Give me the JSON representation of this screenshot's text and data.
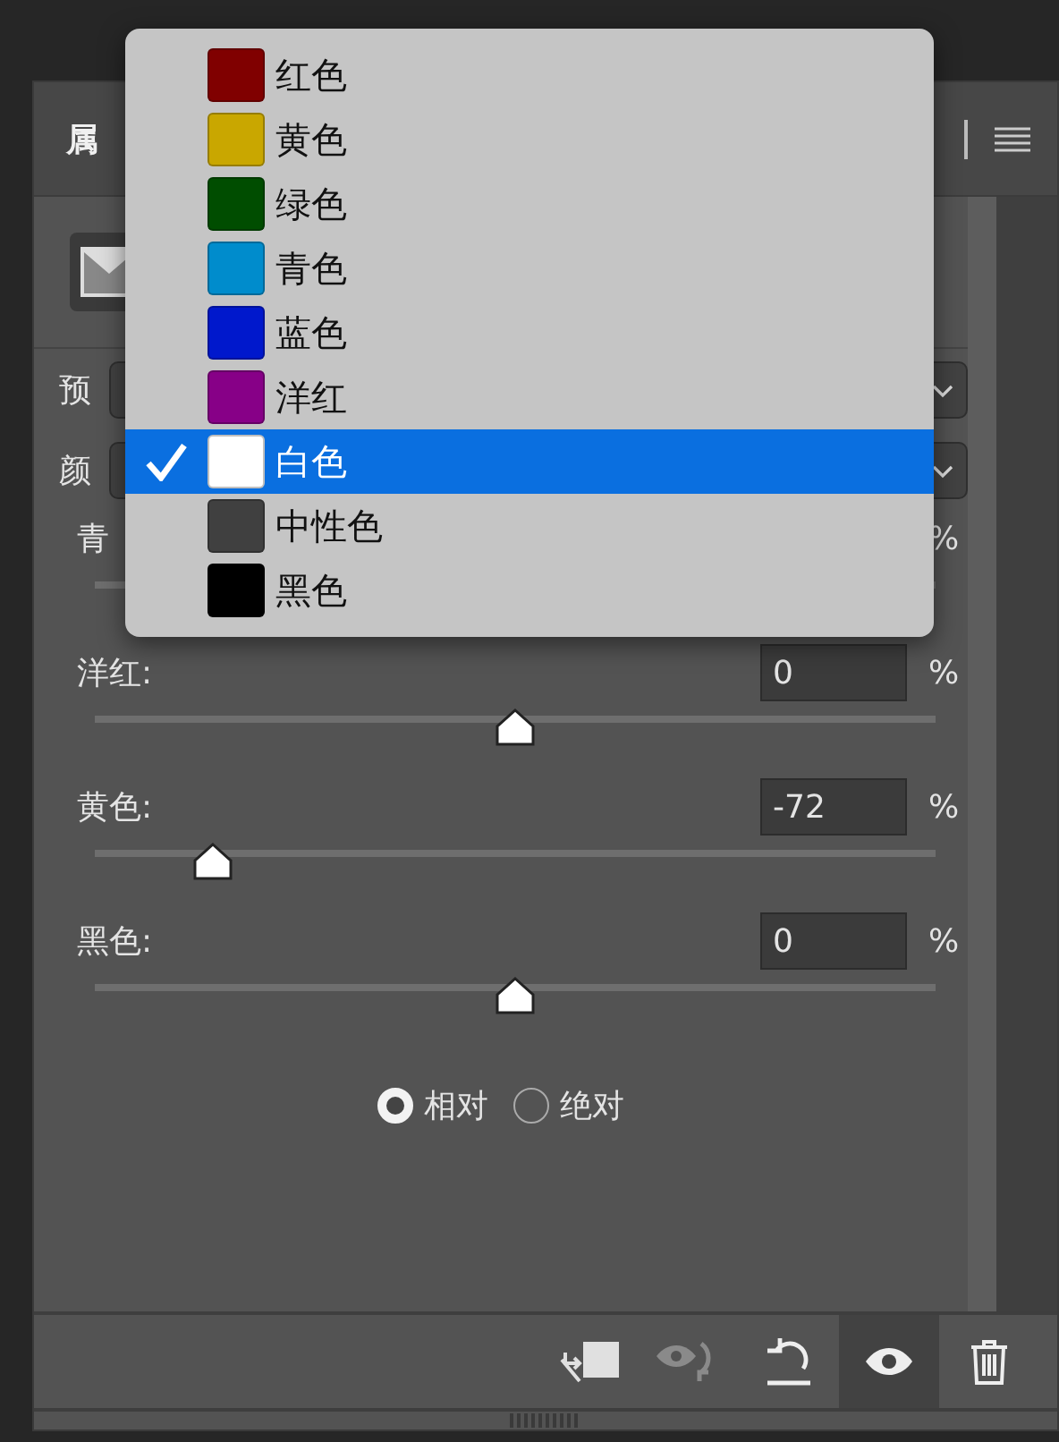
{
  "panel": {
    "title": "属"
  },
  "fields": [
    {
      "label": "预"
    },
    {
      "label": "颜"
    }
  ],
  "sliders": [
    {
      "label": "青",
      "unit": "%"
    },
    {
      "label": "洋红:",
      "value": "0",
      "unit": "%",
      "level": 0.5
    },
    {
      "label": "黄色:",
      "value": "-72",
      "unit": "%",
      "level": 0.14
    },
    {
      "label": "黑色:",
      "value": "0",
      "unit": "%",
      "level": 0.5
    }
  ],
  "modes": [
    {
      "label": "相对",
      "selected": true
    },
    {
      "label": "绝对",
      "selected": false
    }
  ],
  "menu": {
    "items": [
      {
        "label": "红色",
        "color": "#800000",
        "selected": false
      },
      {
        "label": "黄色",
        "color": "#c9a700",
        "selected": false
      },
      {
        "label": "绿色",
        "color": "#004d00",
        "selected": false
      },
      {
        "label": "青色",
        "color": "#008ccc",
        "selected": false
      },
      {
        "label": "蓝色",
        "color": "#0018cc",
        "selected": false
      },
      {
        "label": "洋红",
        "color": "#870087",
        "selected": false
      },
      {
        "label": "白色",
        "color": "#ffffff",
        "selected": true
      },
      {
        "label": "中性色",
        "color": "#404040",
        "selected": false
      },
      {
        "label": "黑色",
        "color": "#000000",
        "selected": false
      }
    ]
  }
}
